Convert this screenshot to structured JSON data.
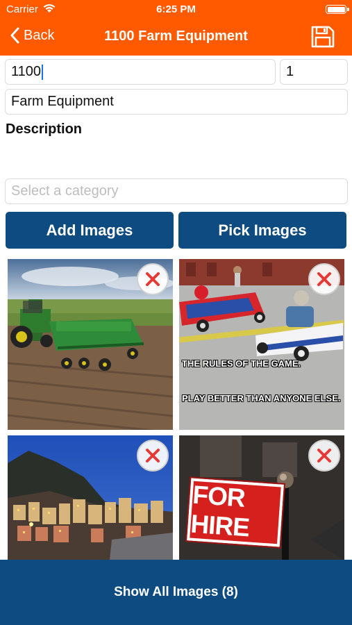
{
  "status_bar": {
    "carrier": "Carrier",
    "time": "6:25 PM"
  },
  "nav": {
    "back_label": "Back",
    "title": "1100 Farm Equipment",
    "save_icon": "floppy-disk-icon"
  },
  "form": {
    "code_value": "1100",
    "quantity_value": "1",
    "name_value": "Farm Equipment",
    "description_label": "Description",
    "category_placeholder": "Select a category"
  },
  "buttons": {
    "add_images": "Add Images",
    "pick_images": "Pick Images"
  },
  "images": [
    {
      "subject": "tractor",
      "delete_icon": "close-icon"
    },
    {
      "subject": "soapbox-race",
      "caption_1": "THE RULES OF THE GAME.",
      "caption_2": "PLAY BETTER THAN ANYONE ELSE.",
      "delete_icon": "close-icon"
    },
    {
      "subject": "coastal-town",
      "delete_icon": "close-icon"
    },
    {
      "subject": "for-hire-sign",
      "sign_text": "FOR HIRE",
      "delete_icon": "close-icon"
    }
  ],
  "bottom_bar": {
    "label": "Show All Images (8)"
  },
  "colors": {
    "header": "#FF5A00",
    "primary": "#0E4B80",
    "delete": "#E53935"
  }
}
